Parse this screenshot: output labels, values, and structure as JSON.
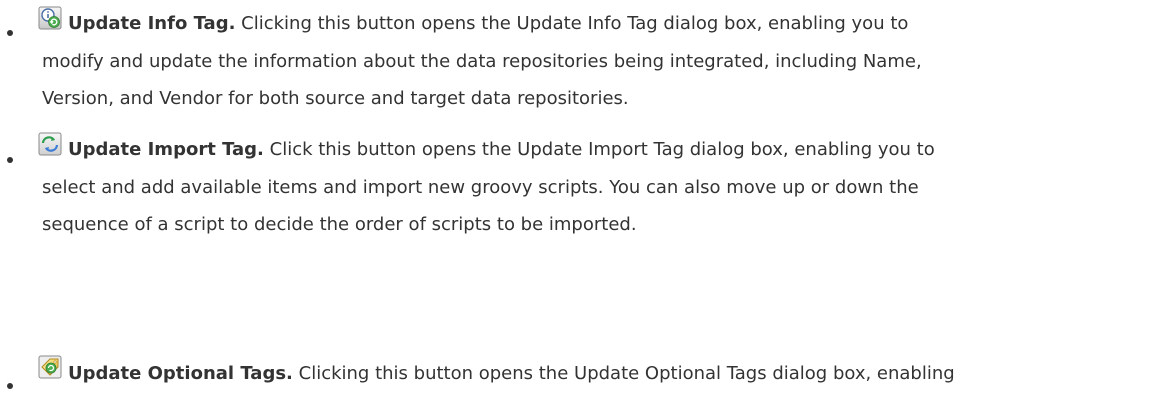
{
  "items": [
    {
      "icon": "info-update-icon",
      "term": "Update Info Tag.",
      "lines": [
        "Clicking this button opens the Update Info Tag dialog box, enabling you to",
        "modify and update the information about the data repositories being integrated, including Name,",
        "Version, and Vendor for both source and target data repositories."
      ]
    },
    {
      "icon": "import-update-icon",
      "term": "Update Import Tag.",
      "lines": [
        "Click this button opens the Update Import Tag dialog box, enabling you to",
        "select and add available items and import new groovy scripts. You can also move up or down the",
        "sequence of a script to decide the order of scripts to be imported."
      ]
    },
    {
      "icon": "optional-tags-update-icon",
      "term": "Update Optional Tags.",
      "lines": [
        "Clicking this button opens the Update Optional Tags dialog box, enabling"
      ]
    }
  ]
}
